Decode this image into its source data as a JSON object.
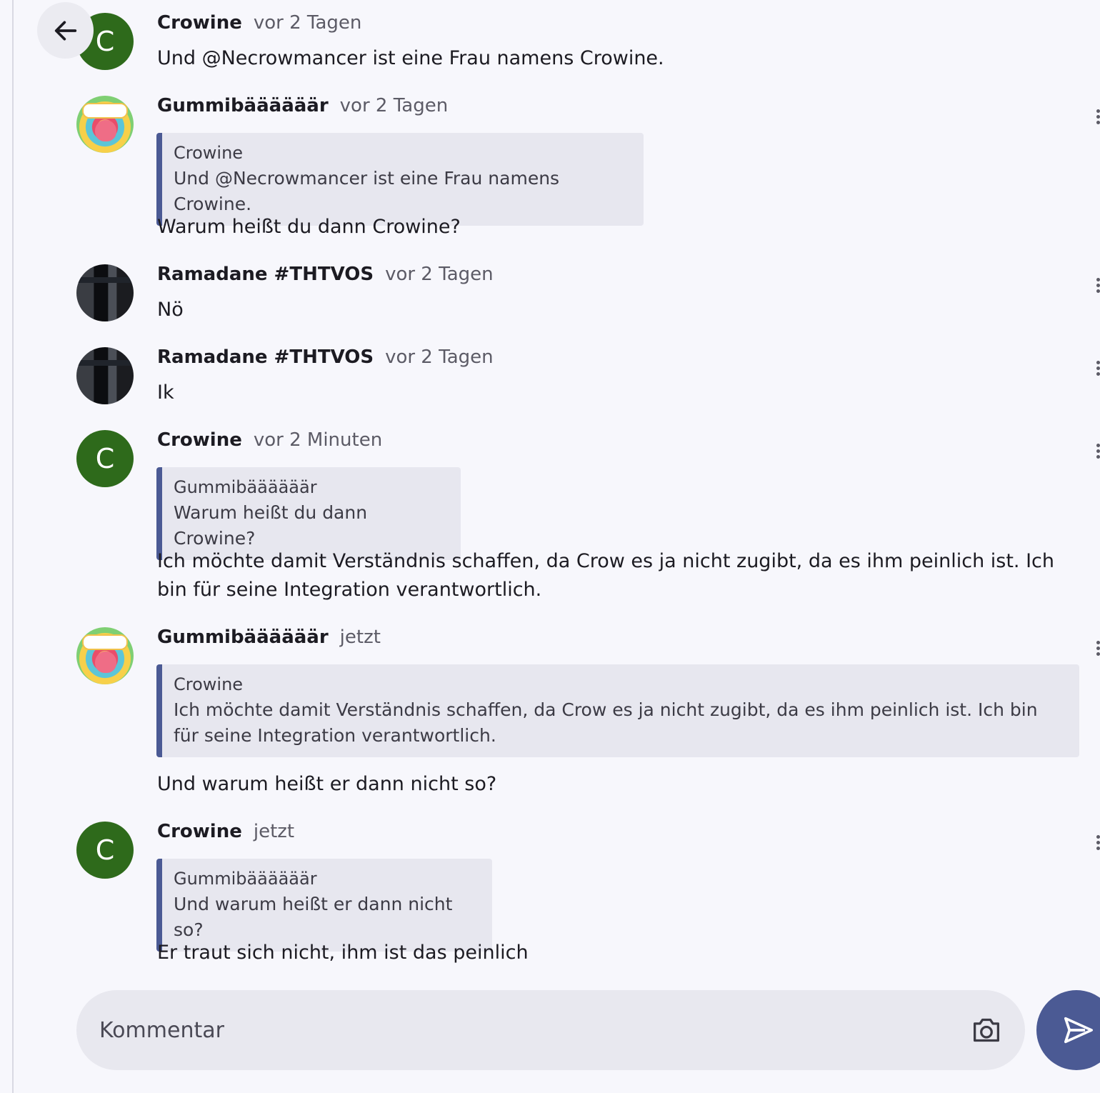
{
  "messages": [
    {
      "author": "Crowine",
      "time": "vor 2 Tagen",
      "avatar": "C",
      "text": "Und @Necrowmancer ist eine Frau namens Crowine."
    },
    {
      "author": "Gummibäääääär",
      "time": "vor 2 Tagen",
      "avatar": "gummy-bear",
      "quote": {
        "author": "Crowine",
        "text": "Und @Necrowmancer ist eine Frau namens Crowine."
      },
      "text": "Warum heißt du dann Crowine?"
    },
    {
      "author": "Ramadane #THTVOS",
      "time": "vor 2 Tagen",
      "avatar": "photo",
      "text": "Nö"
    },
    {
      "author": "Ramadane #THTVOS",
      "time": "vor 2 Tagen",
      "avatar": "photo",
      "text": "Ik"
    },
    {
      "author": "Crowine",
      "time": "vor 2 Minuten",
      "avatar": "C",
      "quote": {
        "author": "Gummibäääääär",
        "text": "Warum heißt du dann Crowine?"
      },
      "text": "Ich möchte damit Verständnis schaffen, da Crow es ja nicht zugibt, da es ihm peinlich ist. Ich bin für seine Integration verantwortlich."
    },
    {
      "author": "Gummibäääääär",
      "time": "jetzt",
      "avatar": "gummy-bear",
      "quote": {
        "author": "Crowine",
        "text": "Ich möchte damit Verständnis schaffen, da Crow es ja nicht zugibt, da es ihm peinlich ist. Ich bin für seine Integration verantwortlich."
      },
      "text": "Und warum heißt er dann nicht so?"
    },
    {
      "author": "Crowine",
      "time": "jetzt",
      "avatar": "C",
      "quote": {
        "author": "Gummibäääääär",
        "text": "Und warum heißt er dann nicht so?"
      },
      "text": "Er traut sich nicht, ihm ist das peinlich"
    }
  ],
  "composer": {
    "placeholder": "Kommentar"
  },
  "icons": {
    "back": "arrow-left-icon",
    "camera": "camera-icon",
    "send": "send-icon",
    "more": "more-vertical-icon"
  },
  "colors": {
    "accent": "#4b5a94",
    "avatar_green": "#2e6a1b",
    "background": "#f7f7fc",
    "quote_bg": "#e7e7ef"
  }
}
